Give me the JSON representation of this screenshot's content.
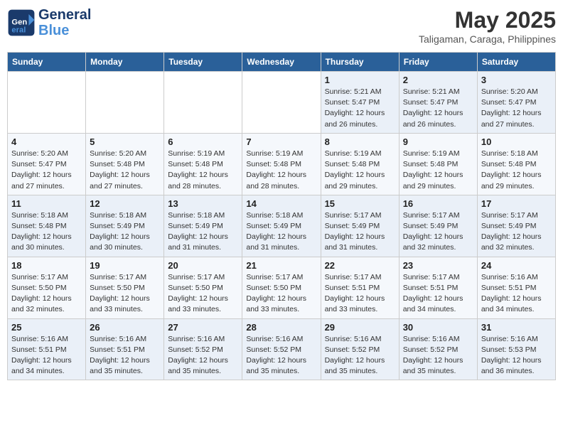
{
  "header": {
    "logo_line1": "General",
    "logo_line2": "Blue",
    "month_year": "May 2025",
    "location": "Taligaman, Caraga, Philippines"
  },
  "weekdays": [
    "Sunday",
    "Monday",
    "Tuesday",
    "Wednesday",
    "Thursday",
    "Friday",
    "Saturday"
  ],
  "weeks": [
    [
      {
        "day": "",
        "info": ""
      },
      {
        "day": "",
        "info": ""
      },
      {
        "day": "",
        "info": ""
      },
      {
        "day": "",
        "info": ""
      },
      {
        "day": "1",
        "info": "Sunrise: 5:21 AM\nSunset: 5:47 PM\nDaylight: 12 hours\nand 26 minutes."
      },
      {
        "day": "2",
        "info": "Sunrise: 5:21 AM\nSunset: 5:47 PM\nDaylight: 12 hours\nand 26 minutes."
      },
      {
        "day": "3",
        "info": "Sunrise: 5:20 AM\nSunset: 5:47 PM\nDaylight: 12 hours\nand 27 minutes."
      }
    ],
    [
      {
        "day": "4",
        "info": "Sunrise: 5:20 AM\nSunset: 5:47 PM\nDaylight: 12 hours\nand 27 minutes."
      },
      {
        "day": "5",
        "info": "Sunrise: 5:20 AM\nSunset: 5:48 PM\nDaylight: 12 hours\nand 27 minutes."
      },
      {
        "day": "6",
        "info": "Sunrise: 5:19 AM\nSunset: 5:48 PM\nDaylight: 12 hours\nand 28 minutes."
      },
      {
        "day": "7",
        "info": "Sunrise: 5:19 AM\nSunset: 5:48 PM\nDaylight: 12 hours\nand 28 minutes."
      },
      {
        "day": "8",
        "info": "Sunrise: 5:19 AM\nSunset: 5:48 PM\nDaylight: 12 hours\nand 29 minutes."
      },
      {
        "day": "9",
        "info": "Sunrise: 5:19 AM\nSunset: 5:48 PM\nDaylight: 12 hours\nand 29 minutes."
      },
      {
        "day": "10",
        "info": "Sunrise: 5:18 AM\nSunset: 5:48 PM\nDaylight: 12 hours\nand 29 minutes."
      }
    ],
    [
      {
        "day": "11",
        "info": "Sunrise: 5:18 AM\nSunset: 5:48 PM\nDaylight: 12 hours\nand 30 minutes."
      },
      {
        "day": "12",
        "info": "Sunrise: 5:18 AM\nSunset: 5:49 PM\nDaylight: 12 hours\nand 30 minutes."
      },
      {
        "day": "13",
        "info": "Sunrise: 5:18 AM\nSunset: 5:49 PM\nDaylight: 12 hours\nand 31 minutes."
      },
      {
        "day": "14",
        "info": "Sunrise: 5:18 AM\nSunset: 5:49 PM\nDaylight: 12 hours\nand 31 minutes."
      },
      {
        "day": "15",
        "info": "Sunrise: 5:17 AM\nSunset: 5:49 PM\nDaylight: 12 hours\nand 31 minutes."
      },
      {
        "day": "16",
        "info": "Sunrise: 5:17 AM\nSunset: 5:49 PM\nDaylight: 12 hours\nand 32 minutes."
      },
      {
        "day": "17",
        "info": "Sunrise: 5:17 AM\nSunset: 5:49 PM\nDaylight: 12 hours\nand 32 minutes."
      }
    ],
    [
      {
        "day": "18",
        "info": "Sunrise: 5:17 AM\nSunset: 5:50 PM\nDaylight: 12 hours\nand 32 minutes."
      },
      {
        "day": "19",
        "info": "Sunrise: 5:17 AM\nSunset: 5:50 PM\nDaylight: 12 hours\nand 33 minutes."
      },
      {
        "day": "20",
        "info": "Sunrise: 5:17 AM\nSunset: 5:50 PM\nDaylight: 12 hours\nand 33 minutes."
      },
      {
        "day": "21",
        "info": "Sunrise: 5:17 AM\nSunset: 5:50 PM\nDaylight: 12 hours\nand 33 minutes."
      },
      {
        "day": "22",
        "info": "Sunrise: 5:17 AM\nSunset: 5:51 PM\nDaylight: 12 hours\nand 33 minutes."
      },
      {
        "day": "23",
        "info": "Sunrise: 5:17 AM\nSunset: 5:51 PM\nDaylight: 12 hours\nand 34 minutes."
      },
      {
        "day": "24",
        "info": "Sunrise: 5:16 AM\nSunset: 5:51 PM\nDaylight: 12 hours\nand 34 minutes."
      }
    ],
    [
      {
        "day": "25",
        "info": "Sunrise: 5:16 AM\nSunset: 5:51 PM\nDaylight: 12 hours\nand 34 minutes."
      },
      {
        "day": "26",
        "info": "Sunrise: 5:16 AM\nSunset: 5:51 PM\nDaylight: 12 hours\nand 35 minutes."
      },
      {
        "day": "27",
        "info": "Sunrise: 5:16 AM\nSunset: 5:52 PM\nDaylight: 12 hours\nand 35 minutes."
      },
      {
        "day": "28",
        "info": "Sunrise: 5:16 AM\nSunset: 5:52 PM\nDaylight: 12 hours\nand 35 minutes."
      },
      {
        "day": "29",
        "info": "Sunrise: 5:16 AM\nSunset: 5:52 PM\nDaylight: 12 hours\nand 35 minutes."
      },
      {
        "day": "30",
        "info": "Sunrise: 5:16 AM\nSunset: 5:52 PM\nDaylight: 12 hours\nand 35 minutes."
      },
      {
        "day": "31",
        "info": "Sunrise: 5:16 AM\nSunset: 5:53 PM\nDaylight: 12 hours\nand 36 minutes."
      }
    ]
  ]
}
